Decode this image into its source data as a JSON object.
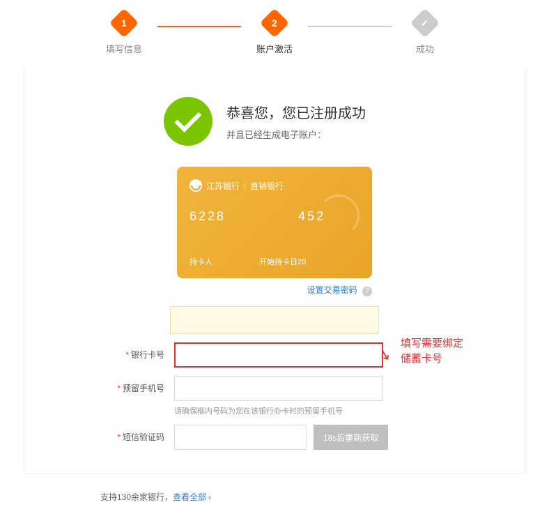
{
  "stepper": {
    "steps": [
      {
        "num": "1",
        "label": "填写信息"
      },
      {
        "num": "2",
        "label": "账户激活"
      },
      {
        "num": "✓",
        "label": "成功"
      }
    ]
  },
  "success": {
    "title": "恭喜您，您已注册成功",
    "subtitle": "并且已经生成电子账户："
  },
  "card": {
    "bank_name": "江苏银行",
    "bank_sub": "直销银行",
    "number_prefix": "6228",
    "number_suffix": "452",
    "holder_label": "持卡人",
    "start_date_label": "开始持卡日",
    "start_date_value": "20"
  },
  "set_password_link": "设置交易密码",
  "help_icon": "?",
  "form": {
    "bank_card": {
      "label": "银行卡号"
    },
    "phone": {
      "label": "预留手机号",
      "hint": "请确保框内号码为您在该银行办卡时的预留手机号"
    },
    "sms": {
      "label": "短信验证码",
      "btn": "18s后重新获取"
    }
  },
  "annotation": {
    "line1": "填写需要绑定",
    "line2": "储蓄卡号"
  },
  "support": {
    "text": "支持130余家银行，",
    "link": "查看全部",
    "chev": "›"
  },
  "required": "*"
}
